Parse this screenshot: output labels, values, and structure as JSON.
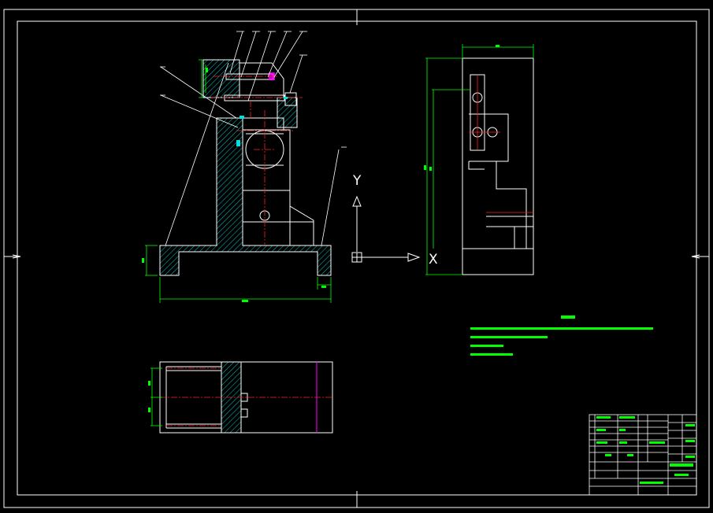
{
  "ucs": {
    "y_label": "Y",
    "x_label": "X"
  },
  "colors": {
    "background": "#000000",
    "outline": "#ffffff",
    "dimension": "#00ff00",
    "centerline": "#ff0000",
    "hatch": "#00cccc",
    "accent": "#ff00ff",
    "note": "#00ff00"
  }
}
